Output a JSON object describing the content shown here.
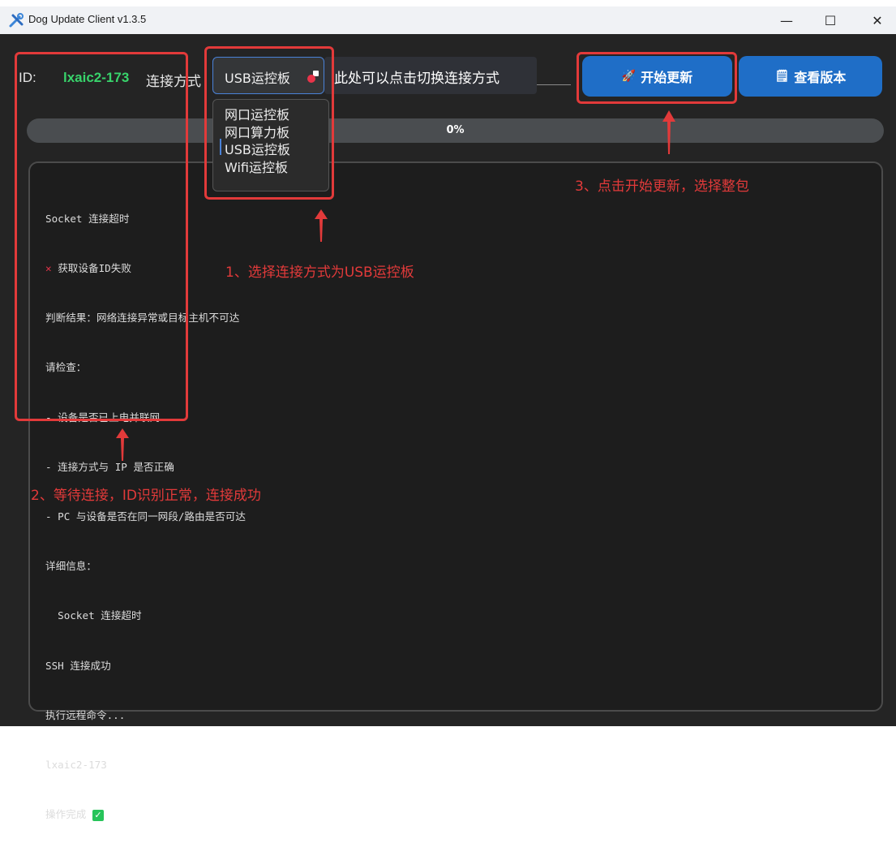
{
  "window": {
    "title": "Dog Update Client v1.3.5",
    "minimize": "—",
    "maximize": "☐",
    "close": "✕"
  },
  "header": {
    "id_label": "ID:",
    "id_value": "lxaic2-173",
    "connection_label": "连接方式",
    "connection_selected": "USB运控板",
    "tooltip": "此处可以点击切换连接方式",
    "start_update": "开始更新",
    "view_version": "查看版本"
  },
  "progress": {
    "value_percent": 0,
    "label": "0%"
  },
  "connection_options": [
    "网口运控板",
    "网口算力板",
    "USB运控板",
    "Wifi运控板"
  ],
  "log": {
    "lines": [
      "Socket 连接超时",
      "获取设备ID失败",
      "判断结果：网络连接异常或目标主机不可达",
      "请检查：",
      "- 设备是否已上电并联网",
      "- 连接方式与 IP 是否正确",
      "- PC 与设备是否在同一网段/路由是否可达",
      "详细信息：",
      "  Socket 连接超时",
      "SSH 连接成功",
      "执行远程命令...",
      "lxaic2-173",
      "操作完成"
    ]
  },
  "annotations": {
    "step1": "1、选择连接方式为USB运控板",
    "step2": "2、等待连接，ID识别正常，连接成功",
    "step3": "3、点击开始更新，选择整包"
  },
  "colors": {
    "accent": "#1f6ec7",
    "annotation": "#e23a3a",
    "id_green": "#38d36b",
    "background": "#242424"
  }
}
